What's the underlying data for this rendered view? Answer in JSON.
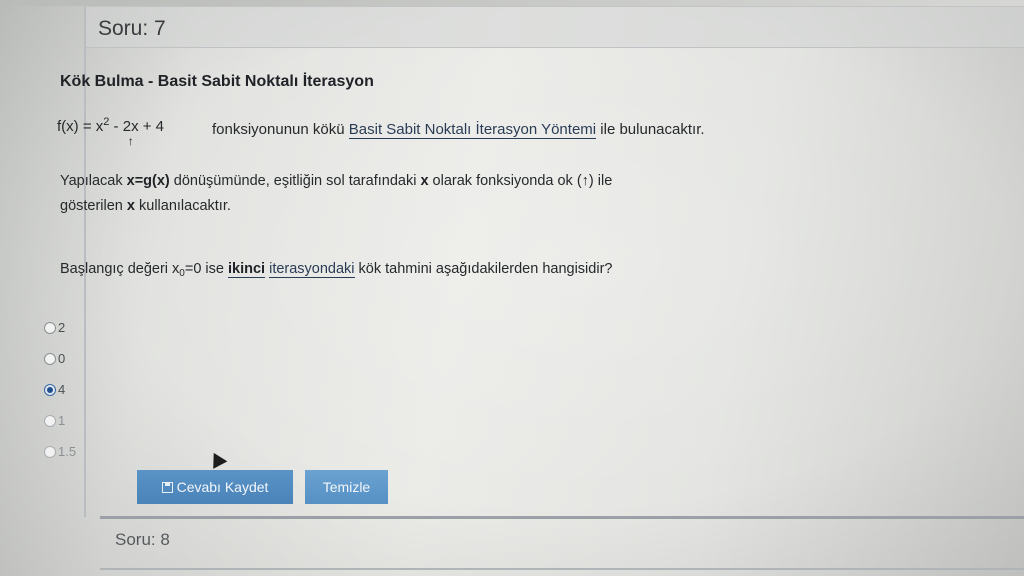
{
  "question": {
    "number_label": "Soru: 7",
    "heading": "Kök Bulma - Basit Sabit Noktalı İterasyon",
    "formula": {
      "prefix": "f(x) = x",
      "exponent": "2",
      "minus": " - ",
      "marked": "2x",
      "suffix": " + 4"
    },
    "line1": {
      "text_a": "fonksiyonunun kökü ",
      "link": "Basit Sabit Noktalı İterasyon Yöntemi",
      "text_b": " ile bulunacaktır."
    },
    "paragraph1": {
      "a": "Yapılacak ",
      "b": "x=g(x)",
      "c": " dönüşümünde, eşitliğin sol tarafındaki ",
      "d": "x",
      "e": " olarak fonksiyonda ok (",
      "arrow": "↑",
      "f": ") ile"
    },
    "paragraph2": {
      "a": "gösterilen ",
      "b": "x",
      "c": " kullanılacaktır."
    },
    "paragraph3": {
      "a": "Başlangıç değeri x",
      "sub": "0",
      "b": "=0 ise ",
      "c": "ikinci",
      "d": " ",
      "e": "iterasyondaki",
      "f": " kök tahmini aşağıdakilerden hangisidir?"
    }
  },
  "options": [
    {
      "label": "2",
      "checked": false
    },
    {
      "label": "0",
      "checked": false
    },
    {
      "label": "4",
      "checked": true
    },
    {
      "label": "1",
      "checked": false
    },
    {
      "label": "1.5",
      "checked": false
    }
  ],
  "buttons": {
    "save": "Cevabı Kaydet",
    "clear": "Temizle"
  },
  "next_question": {
    "number_label": "Soru: 8"
  },
  "colors": {
    "button_primary": "#4a83b8",
    "link": "#2a3c55"
  }
}
